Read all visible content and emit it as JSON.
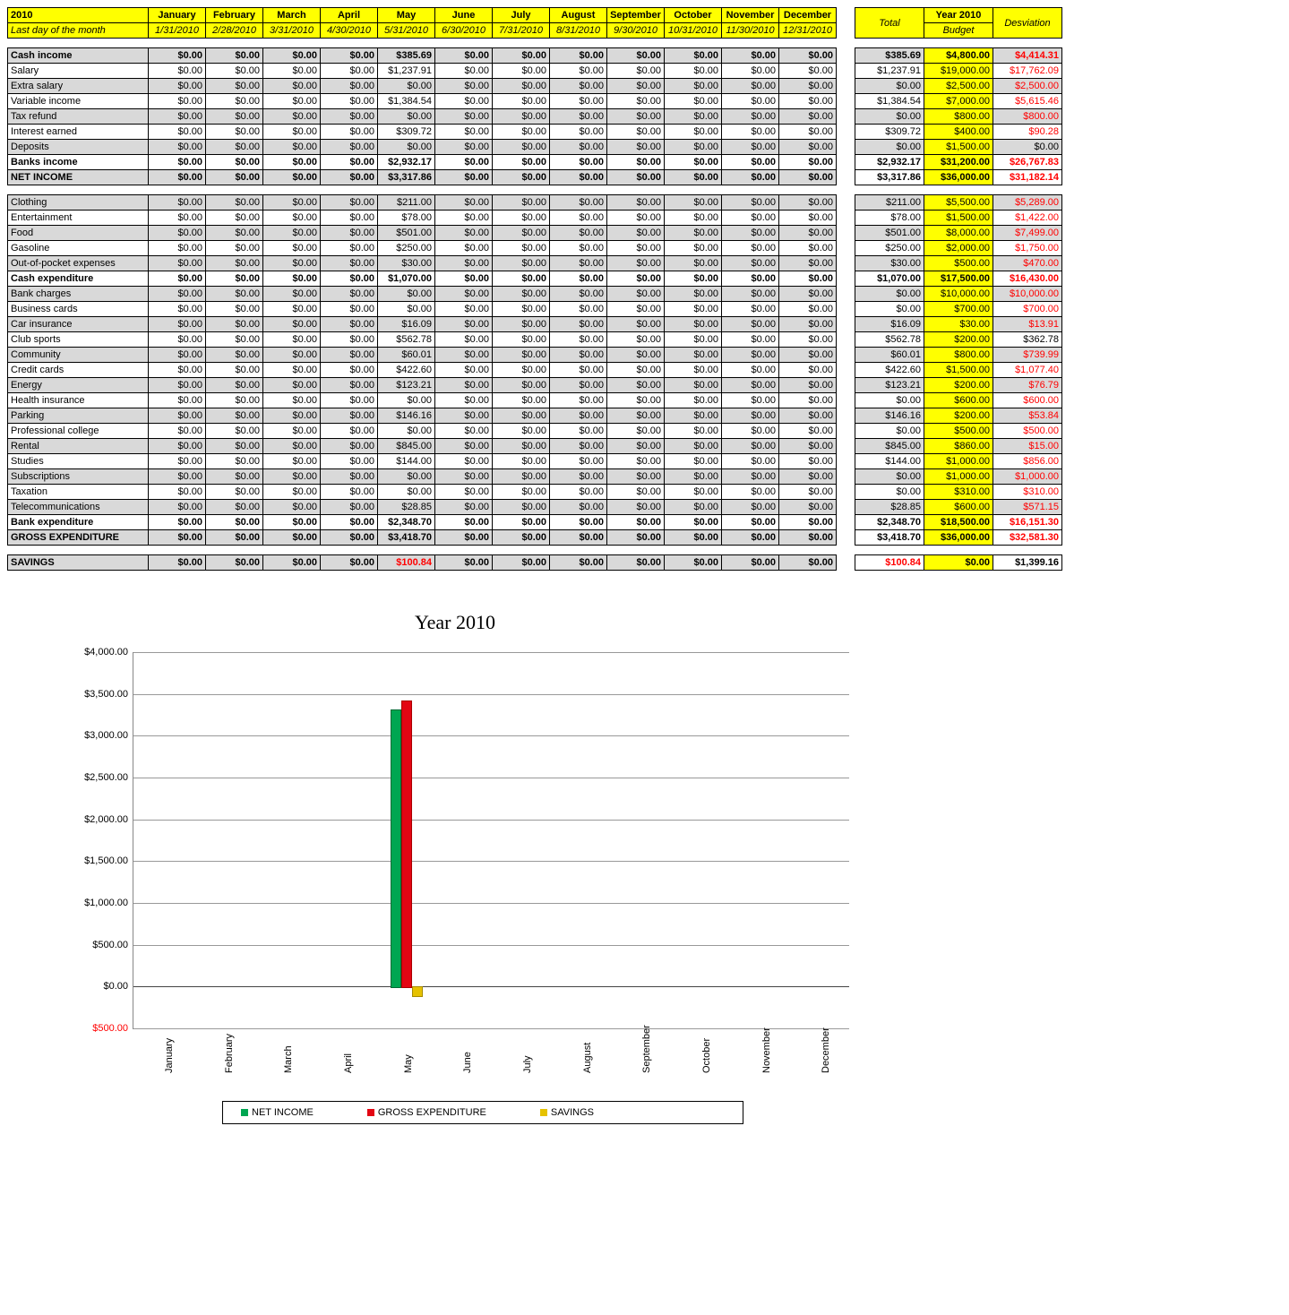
{
  "header": {
    "year_label": "2010",
    "sub_label": "Last day of the month",
    "months": [
      "January",
      "February",
      "March",
      "April",
      "May",
      "June",
      "July",
      "August",
      "September",
      "October",
      "November",
      "December"
    ],
    "dates": [
      "1/31/2010",
      "2/28/2010",
      "3/31/2010",
      "4/30/2010",
      "5/31/2010",
      "6/30/2010",
      "7/31/2010",
      "8/31/2010",
      "9/30/2010",
      "10/31/2010",
      "11/30/2010",
      "12/31/2010"
    ]
  },
  "side_header": {
    "total": "Total",
    "budget_l1": "Year 2010",
    "budget_l2": "Budget",
    "dev": "Desviation"
  },
  "sections": [
    {
      "rows": [
        {
          "label": "Cash income",
          "shade": true,
          "bold": true,
          "may": "$385.69",
          "total": "$385.69",
          "budget": "$4,800.00",
          "dev": "$4,414.31",
          "dev_red": true
        },
        {
          "label": "Salary",
          "may": "$1,237.91",
          "total": "$1,237.91",
          "budget": "$19,000.00",
          "dev": "$17,762.09",
          "dev_red": true
        },
        {
          "label": "Extra salary",
          "shade": true,
          "may": "$0.00",
          "total": "$0.00",
          "budget": "$2,500.00",
          "dev": "$2,500.00",
          "dev_red": true
        },
        {
          "label": "Variable income",
          "may": "$1,384.54",
          "total": "$1,384.54",
          "budget": "$7,000.00",
          "dev": "$5,615.46",
          "dev_red": true
        },
        {
          "label": "Tax refund",
          "shade": true,
          "may": "$0.00",
          "total": "$0.00",
          "budget": "$800.00",
          "dev": "$800.00",
          "dev_red": true
        },
        {
          "label": "Interest earned",
          "may": "$309.72",
          "total": "$309.72",
          "budget": "$400.00",
          "dev": "$90.28",
          "dev_red": true
        },
        {
          "label": "Deposits",
          "shade": true,
          "may": "$0.00",
          "total": "$0.00",
          "budget": "$1,500.00",
          "dev": "$0.00"
        },
        {
          "label": "Banks income",
          "bold": true,
          "may": "$2,932.17",
          "total": "$2,932.17",
          "budget": "$31,200.00",
          "dev": "$26,767.83",
          "dev_red": true
        },
        {
          "label": "NET INCOME",
          "shade": true,
          "bold": true,
          "yellow": true,
          "may": "$3,317.86",
          "total": "$3,317.86",
          "budget": "$36,000.00",
          "dev": "$31,182.14",
          "dev_red": true
        }
      ]
    },
    {
      "rows": [
        {
          "label": "Clothing",
          "shade": true,
          "may": "$211.00",
          "total": "$211.00",
          "budget": "$5,500.00",
          "dev": "$5,289.00",
          "dev_red": true
        },
        {
          "label": "Entertainment",
          "may": "$78.00",
          "total": "$78.00",
          "budget": "$1,500.00",
          "dev": "$1,422.00",
          "dev_red": true
        },
        {
          "label": "Food",
          "shade": true,
          "may": "$501.00",
          "total": "$501.00",
          "budget": "$8,000.00",
          "dev": "$7,499.00",
          "dev_red": true
        },
        {
          "label": "Gasoline",
          "may": "$250.00",
          "total": "$250.00",
          "budget": "$2,000.00",
          "dev": "$1,750.00",
          "dev_red": true
        },
        {
          "label": "Out-of-pocket expenses",
          "shade": true,
          "may": "$30.00",
          "total": "$30.00",
          "budget": "$500.00",
          "dev": "$470.00",
          "dev_red": true
        },
        {
          "label": "Cash expenditure",
          "bold": true,
          "may": "$1,070.00",
          "total": "$1,070.00",
          "budget": "$17,500.00",
          "dev": "$16,430.00",
          "dev_red": true
        },
        {
          "label": "Bank charges",
          "shade": true,
          "may": "$0.00",
          "total": "$0.00",
          "budget": "$10,000.00",
          "dev": "$10,000.00",
          "dev_red": true
        },
        {
          "label": "Business cards",
          "may": "$0.00",
          "total": "$0.00",
          "budget": "$700.00",
          "dev": "$700.00",
          "dev_red": true
        },
        {
          "label": "Car insurance",
          "shade": true,
          "may": "$16.09",
          "total": "$16.09",
          "budget": "$30.00",
          "dev": "$13.91",
          "dev_red": true
        },
        {
          "label": "Club sports",
          "may": "$562.78",
          "total": "$562.78",
          "budget": "$200.00",
          "dev": "$362.78"
        },
        {
          "label": "Community",
          "shade": true,
          "may": "$60.01",
          "total": "$60.01",
          "budget": "$800.00",
          "dev": "$739.99",
          "dev_red": true
        },
        {
          "label": "Credit cards",
          "may": "$422.60",
          "total": "$422.60",
          "budget": "$1,500.00",
          "dev": "$1,077.40",
          "dev_red": true
        },
        {
          "label": "Energy",
          "shade": true,
          "may": "$123.21",
          "total": "$123.21",
          "budget": "$200.00",
          "dev": "$76.79",
          "dev_red": true
        },
        {
          "label": "Health insurance",
          "may": "$0.00",
          "total": "$0.00",
          "budget": "$600.00",
          "dev": "$600.00",
          "dev_red": true
        },
        {
          "label": "Parking",
          "shade": true,
          "may": "$146.16",
          "total": "$146.16",
          "budget": "$200.00",
          "dev": "$53.84",
          "dev_red": true
        },
        {
          "label": "Professional college",
          "may": "$0.00",
          "total": "$0.00",
          "budget": "$500.00",
          "dev": "$500.00",
          "dev_red": true
        },
        {
          "label": "Rental",
          "shade": true,
          "may": "$845.00",
          "total": "$845.00",
          "budget": "$860.00",
          "dev": "$15.00",
          "dev_red": true
        },
        {
          "label": "Studies",
          "may": "$144.00",
          "total": "$144.00",
          "budget": "$1,000.00",
          "dev": "$856.00",
          "dev_red": true
        },
        {
          "label": "Subscriptions",
          "shade": true,
          "may": "$0.00",
          "total": "$0.00",
          "budget": "$1,000.00",
          "dev": "$1,000.00",
          "dev_red": true
        },
        {
          "label": "Taxation",
          "may": "$0.00",
          "total": "$0.00",
          "budget": "$310.00",
          "dev": "$310.00",
          "dev_red": true
        },
        {
          "label": "Telecommunications",
          "shade": true,
          "may": "$28.85",
          "total": "$28.85",
          "budget": "$600.00",
          "dev": "$571.15",
          "dev_red": true
        },
        {
          "label": "Bank expenditure",
          "bold": true,
          "may": "$2,348.70",
          "total": "$2,348.70",
          "budget": "$18,500.00",
          "dev": "$16,151.30",
          "dev_red": true
        },
        {
          "label": "GROSS EXPENDITURE",
          "shade": true,
          "bold": true,
          "yellow": true,
          "may": "$3,418.70",
          "total": "$3,418.70",
          "budget": "$36,000.00",
          "dev": "$32,581.30",
          "dev_red": true
        }
      ]
    },
    {
      "rows": [
        {
          "label": "SAVINGS",
          "shade": true,
          "bold": true,
          "yellow": true,
          "may": "$100.84",
          "may_red": true,
          "total": "$100.84",
          "total_red": true,
          "budget": "$0.00",
          "dev": "$1,399.16"
        }
      ]
    }
  ],
  "zero": "$0.00",
  "chart_data": {
    "type": "bar",
    "title": "Year 2010",
    "categories": [
      "January",
      "February",
      "March",
      "April",
      "May",
      "June",
      "July",
      "August",
      "September",
      "October",
      "November",
      "December"
    ],
    "series": [
      {
        "name": "NET INCOME",
        "color": "green",
        "values": [
          0,
          0,
          0,
          0,
          3317.86,
          0,
          0,
          0,
          0,
          0,
          0,
          0
        ]
      },
      {
        "name": "GROSS EXPENDITURE",
        "color": "red",
        "values": [
          0,
          0,
          0,
          0,
          3418.7,
          0,
          0,
          0,
          0,
          0,
          0,
          0
        ]
      },
      {
        "name": "SAVINGS",
        "color": "yellow",
        "values": [
          0,
          0,
          0,
          0,
          -100.84,
          0,
          0,
          0,
          0,
          0,
          0,
          0
        ]
      }
    ],
    "ylim": [
      -500,
      4000
    ],
    "yticks": [
      "$4,000.00",
      "$3,500.00",
      "$3,000.00",
      "$2,500.00",
      "$2,000.00",
      "$1,500.00",
      "$1,000.00",
      "$500.00",
      "$0.00",
      "$500.00"
    ],
    "ytick_vals": [
      4000,
      3500,
      3000,
      2500,
      2000,
      1500,
      1000,
      500,
      0,
      -500
    ]
  },
  "legend": {
    "a": "NET INCOME",
    "b": "GROSS EXPENDITURE",
    "c": "SAVINGS"
  }
}
